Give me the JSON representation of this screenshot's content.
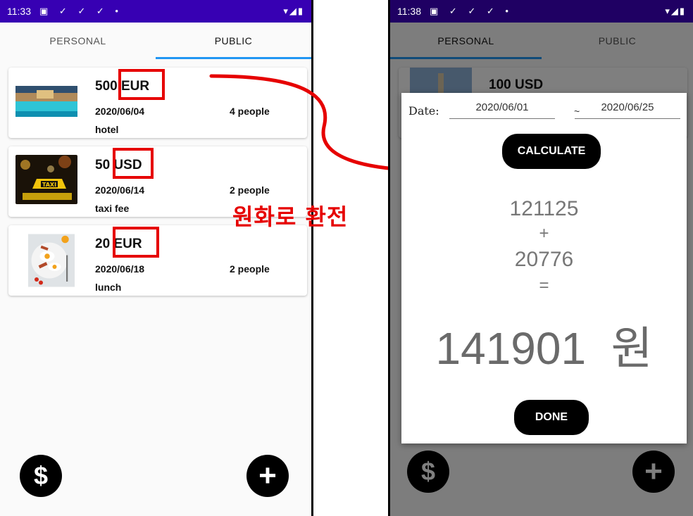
{
  "left_screen": {
    "status_time": "11:33",
    "tabs": [
      {
        "label": "PERSONAL"
      },
      {
        "label": "PUBLIC"
      }
    ],
    "cards": [
      {
        "amount": "500",
        "currency": "EUR",
        "date": "2020/06/04",
        "people": "4 people",
        "memo": "hotel",
        "thumb": "hotel-pool-photo"
      },
      {
        "amount": "50",
        "currency": "USD",
        "date": "2020/06/14",
        "people": "2 people",
        "memo": "taxi fee",
        "thumb": "taxi-sign-photo"
      },
      {
        "amount": "20",
        "currency": "EUR",
        "date": "2020/06/18",
        "people": "2 people",
        "memo": "lunch",
        "thumb": "breakfast-plate-photo"
      }
    ],
    "fab_left": {
      "icon": "dollar-icon",
      "glyph": "$"
    },
    "fab_right": {
      "icon": "plus-icon",
      "glyph": "+"
    }
  },
  "annotation": {
    "text": "원화로 환전",
    "color": "#e60000"
  },
  "right_screen": {
    "status_time": "11:38",
    "tabs": [
      {
        "label": "PERSONAL"
      },
      {
        "label": "PUBLIC"
      }
    ],
    "background_card_amount": "100 USD",
    "dialog": {
      "date_label": "Date:",
      "start_date": "2020/06/01",
      "separator": "~",
      "end_date": "2020/06/25",
      "calculate_label": "CALCULATE",
      "term1": "121125",
      "plus": "+",
      "term2": "20776",
      "equals": "=",
      "result": "141901",
      "result_unit": "원",
      "done_label": "DONE"
    },
    "fab_left": {
      "icon": "dollar-icon",
      "glyph": "$"
    },
    "fab_right": {
      "icon": "plus-icon",
      "glyph": "+"
    }
  },
  "colors": {
    "status_bar": "#3700b3",
    "tab_indicator": "#2196f3",
    "highlight": "#e60000"
  }
}
